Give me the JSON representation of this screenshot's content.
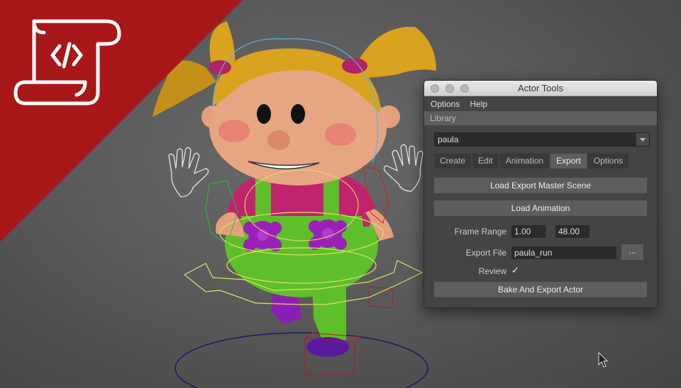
{
  "window": {
    "title": "Actor Tools",
    "menu": [
      "Options",
      "Help"
    ],
    "section_label": "Library",
    "actor_select": "paula",
    "tabs": [
      "Create",
      "Edit",
      "Animation",
      "Export",
      "Options"
    ],
    "active_tab": "Export",
    "export": {
      "load_master_label": "Load Export Master Scene",
      "load_anim_label": "Load Animation",
      "frame_range_label": "Frame Range",
      "frame_start": "1.00",
      "frame_end": "48.00",
      "export_file_label": "Export File",
      "export_file_value": "paula_run",
      "browse_label": "...",
      "review_label": "Review",
      "review_checked": "✓",
      "bake_label": "Bake And Export Actor"
    }
  },
  "colors": {
    "banner": "#a81818",
    "character_hair": "#d9a21f",
    "character_shirt": "#c0246e",
    "character_overalls": "#5fbf2a",
    "character_flowers": "#9a21b8"
  },
  "icons": [
    "script-scroll-icon",
    "mouse-cursor-icon"
  ]
}
